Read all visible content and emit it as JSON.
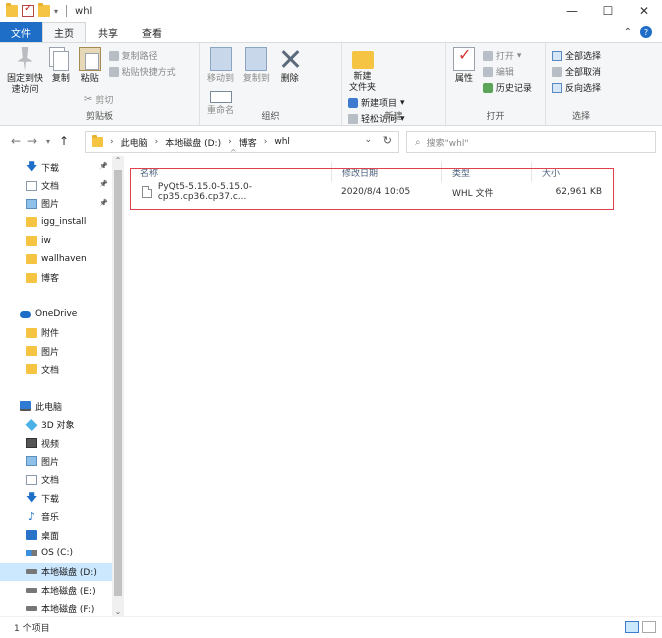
{
  "window": {
    "title": "whl"
  },
  "window_controls": {
    "minimize": "—",
    "maximize": "☐",
    "close": "✕"
  },
  "tabs": [
    {
      "label": "文件"
    },
    {
      "label": "主页"
    },
    {
      "label": "共享"
    },
    {
      "label": "查看"
    }
  ],
  "ribbon": {
    "clipboard": {
      "group_label": "剪贴板",
      "pin": "固定到快\n速访问",
      "copy": "复制",
      "paste": "粘贴",
      "copy_path": "复制路径",
      "paste_shortcut": "粘贴快捷方式",
      "cut": "剪切"
    },
    "organize": {
      "group_label": "组织",
      "move_to": "移动到",
      "copy_to": "复制到",
      "delete": "删除",
      "rename": "重命名"
    },
    "new": {
      "group_label": "新建",
      "new_folder": "新建\n文件夹",
      "new_item": "新建项目",
      "easy_access": "轻松访问"
    },
    "open": {
      "group_label": "打开",
      "properties": "属性",
      "open": "打开",
      "edit": "编辑",
      "history": "历史记录"
    },
    "select": {
      "group_label": "选择",
      "select_all": "全部选择",
      "select_none": "全部取消",
      "invert": "反向选择"
    }
  },
  "address": {
    "breadcrumbs": [
      "此电脑",
      "本地磁盘 (D:)",
      "博客",
      "whl"
    ],
    "search_placeholder": "搜索\"whl\""
  },
  "nav": {
    "items": [
      {
        "label": "下载",
        "icon": "download-icon",
        "pinned": true
      },
      {
        "label": "文档",
        "icon": "document-icon",
        "pinned": true
      },
      {
        "label": "图片",
        "icon": "picture-icon",
        "pinned": true
      },
      {
        "label": "igg_install",
        "icon": "folder-icon"
      },
      {
        "label": "iw",
        "icon": "folder-icon"
      },
      {
        "label": "wallhaven",
        "icon": "folder-icon"
      },
      {
        "label": "博客",
        "icon": "folder-icon"
      },
      {
        "label": "",
        "icon": ""
      },
      {
        "label": "OneDrive",
        "icon": "cloud-icon",
        "level": 0
      },
      {
        "label": "附件",
        "icon": "folder-icon"
      },
      {
        "label": "图片",
        "icon": "folder-icon"
      },
      {
        "label": "文档",
        "icon": "folder-icon"
      },
      {
        "label": "",
        "icon": ""
      },
      {
        "label": "此电脑",
        "icon": "computer-icon",
        "level": 0
      },
      {
        "label": "3D 对象",
        "icon": "3d-objects-icon"
      },
      {
        "label": "视频",
        "icon": "video-icon"
      },
      {
        "label": "图片",
        "icon": "picture-icon"
      },
      {
        "label": "文档",
        "icon": "document-icon"
      },
      {
        "label": "下载",
        "icon": "download-icon"
      },
      {
        "label": "音乐",
        "icon": "music-icon"
      },
      {
        "label": "桌面",
        "icon": "desktop-icon"
      },
      {
        "label": "OS (C:)",
        "icon": "os-drive-icon"
      },
      {
        "label": "本地磁盘 (D:)",
        "icon": "drive-icon",
        "selected": true
      },
      {
        "label": "本地磁盘 (E:)",
        "icon": "drive-icon"
      },
      {
        "label": "本地磁盘 (F:)",
        "icon": "drive-icon"
      },
      {
        "label": "",
        "icon": ""
      },
      {
        "label": "网络",
        "icon": "network-icon",
        "level": 0
      }
    ]
  },
  "columns": {
    "name": "名称",
    "date": "修改日期",
    "type": "类型",
    "size": "大小"
  },
  "files": [
    {
      "name": "PyQt5-5.15.0-5.15.0-cp35.cp36.cp37.c...",
      "date": "2020/8/4 10:05",
      "type": "WHL 文件",
      "size": "62,961 KB"
    }
  ],
  "status": {
    "count": "1 个项目"
  },
  "colors": {
    "accent": "#1e6ec8",
    "highlight_border": "#e0424b",
    "selected_bg": "#cce8ff"
  }
}
